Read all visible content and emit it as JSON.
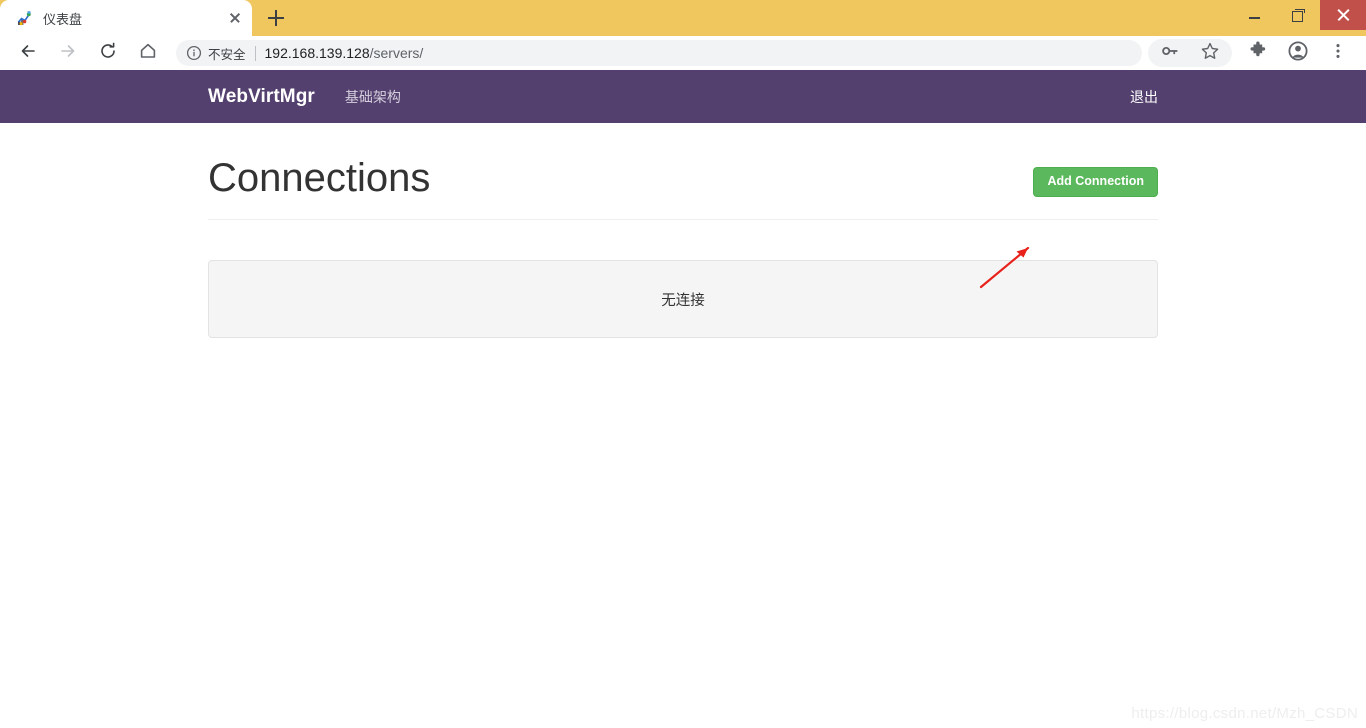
{
  "browser": {
    "tab": {
      "title": "仪表盘",
      "favicon_icon": "chart-favicon",
      "close_icon": "close-icon"
    },
    "new_tab_icon": "plus-icon",
    "window_controls": {
      "minimize_icon": "minimize-icon",
      "maximize_icon": "maximize-icon",
      "close_icon": "close-icon"
    },
    "toolbar": {
      "back_icon": "arrow-left-icon",
      "forward_icon": "arrow-right-icon",
      "reload_icon": "reload-icon",
      "home_icon": "home-icon",
      "security_icon": "info-circle-icon",
      "security_text": "不安全",
      "url_host": "192.168.139.128",
      "url_path": "/servers/",
      "url_full": "192.168.139.128/servers/",
      "key_icon": "key-icon",
      "bookmark_icon": "star-icon",
      "extensions_icon": "puzzle-icon",
      "profile_icon": "account-circle-icon",
      "menu_icon": "three-dots-vertical-icon"
    }
  },
  "navbar": {
    "brand": "WebVirtMgr",
    "links": [
      {
        "label": "基础架构"
      }
    ],
    "logout_label": "退出",
    "background_color": "#54406f"
  },
  "main": {
    "page_title": "Connections",
    "add_connection_label": "Add Connection",
    "add_connection_color": "#5cb85c",
    "empty_panel_text": "无连接"
  },
  "annotation": {
    "arrow_color": "#e8211a",
    "arrow_icon": "arrow-up-right-annotation"
  },
  "watermark": {
    "text": "https://blog.csdn.net/Mzh_CSDN"
  }
}
